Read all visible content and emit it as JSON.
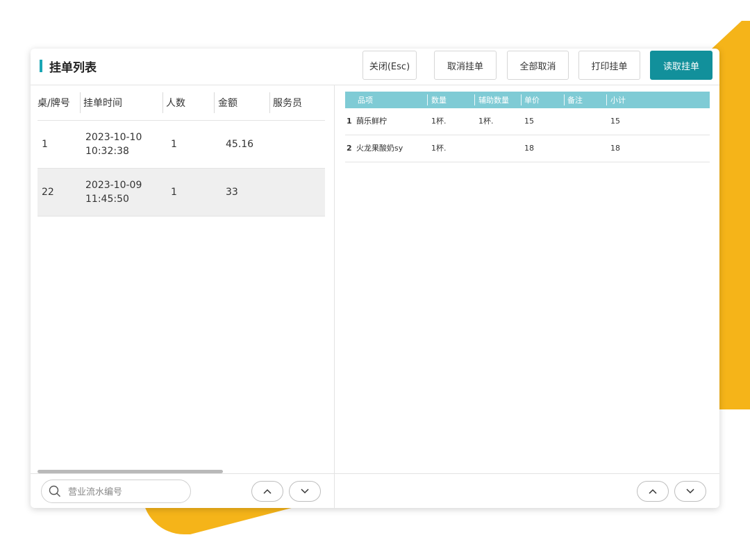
{
  "window": {
    "title": "挂单列表",
    "buttons": {
      "close": "关闭(Esc)",
      "cancel_hold": "取消挂单",
      "cancel_all": "全部取消",
      "print_hold": "打印挂单",
      "read_hold": "读取挂单"
    },
    "accent_color": "#1aa6b5",
    "primary_color": "#12909b"
  },
  "left_table": {
    "headers": [
      "桌/牌号",
      "挂单时间",
      "人数",
      "金额",
      "服务员"
    ],
    "rows": [
      {
        "table": "1",
        "date": "2023-10-10",
        "time": "10:32:38",
        "people": "1",
        "amount": "45.16",
        "waiter": ""
      },
      {
        "table": "22",
        "date": "2023-10-09",
        "time": "11:45:50",
        "people": "1",
        "amount": "33",
        "waiter": ""
      }
    ],
    "selected_row": 1
  },
  "search": {
    "placeholder": "营业流水编号",
    "value": ""
  },
  "right_table": {
    "headers": [
      "品项",
      "数量",
      "辅助数量",
      "单价",
      "备注",
      "小计"
    ],
    "header_color": "#7fcbd5",
    "rows": [
      {
        "index": "1",
        "item": "蓢乐鲜柠",
        "qty": "1杯.",
        "aux_qty": "1杯.",
        "price": "15",
        "note": "",
        "subtotal": "15"
      },
      {
        "index": "2",
        "item": "火龙果酸奶sy",
        "qty": "1杯.",
        "aux_qty": "",
        "price": "18",
        "note": "",
        "subtotal": "18"
      }
    ]
  },
  "icons": {
    "search": "search-icon",
    "up": "chevron-up-icon",
    "down": "chevron-down-icon"
  },
  "decor_color": "#f5b419"
}
